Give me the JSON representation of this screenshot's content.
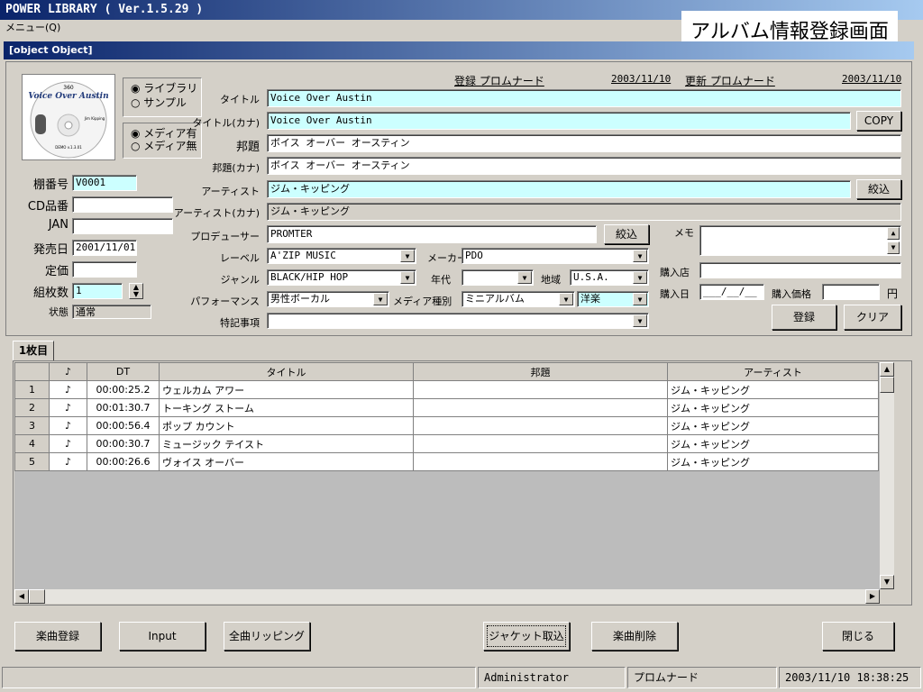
{
  "window": {
    "title": "POWER  LIBRARY ( Ver.1.5.29 )",
    "menu": "メニュー(Q)",
    "overlay_caption": "アルバム情報登録画面"
  },
  "form": {
    "title": {
      "label": "タイトル",
      "value": "Voice Over Austin"
    },
    "cover": {
      "top": "360",
      "title": "Voice Over Austin",
      "artist": "Jim Kipping",
      "demo": "DEMO v.1.3.01"
    },
    "source_radio": [
      {
        "label": "ライブラリ",
        "checked": true
      },
      {
        "label": "サンプル",
        "checked": false
      }
    ],
    "media_radio": [
      {
        "label": "メディア有",
        "checked": true
      },
      {
        "label": "メディア無",
        "checked": false
      }
    ],
    "left_fields": {
      "shelf_no": {
        "label": "棚番号",
        "value": "V0001"
      },
      "cd_no": {
        "label": "CD品番",
        "value": ""
      },
      "jan": {
        "label": "JAN",
        "value": ""
      },
      "release": {
        "label": "発売日",
        "value": "2001/11/01"
      },
      "price": {
        "label": "定価",
        "value": ""
      },
      "discs": {
        "label": "組枚数",
        "value": "1"
      },
      "status": {
        "label": "状態",
        "value": "通常"
      }
    },
    "registered": {
      "label": "登録 プロムナード",
      "date": "2003/11/10"
    },
    "updated": {
      "label": "更新 プロムナード",
      "date": "2003/11/10"
    },
    "title_kana": {
      "label": "タイトル(カナ)",
      "value": "Voice Over Austin"
    },
    "copy_button": "COPY",
    "jp_title": {
      "label": "邦題",
      "value": "ボイス オーバー オースティン"
    },
    "jp_title_kana": {
      "label": "邦題(カナ)",
      "value": "ボイス オーバー オースティン"
    },
    "artist": {
      "label": "アーティスト",
      "value": "ジム・キッピング"
    },
    "artist_kana": {
      "label": "アーティスト(カナ)",
      "value": "ジム・キッピング"
    },
    "narrow_button": "絞込",
    "producer": {
      "label": "プロデューサー",
      "value": "PROMTER"
    },
    "label": {
      "label": "レーベル",
      "value": "A'ZIP MUSIC"
    },
    "maker": {
      "label": "メーカー",
      "value": "PDO"
    },
    "genre": {
      "label": "ジャンル",
      "value": "BLACK/HIP HOP"
    },
    "era": {
      "label": "年代",
      "value": ""
    },
    "region": {
      "label": "地域",
      "value": "U.S.A."
    },
    "performance": {
      "label": "パフォーマンス",
      "value": "男性ボーカル"
    },
    "media_type": {
      "label": "メディア種別",
      "value": "ミニアルバム",
      "value2": "洋楽"
    },
    "notes": {
      "label": "特記事項",
      "value": ""
    },
    "memo": {
      "label": "メモ",
      "value": ""
    },
    "shop": {
      "label": "購入店",
      "value": ""
    },
    "purchase_date": {
      "label": "購入日",
      "value": "___/__/__"
    },
    "purchase_price": {
      "label": "購入価格",
      "value": "",
      "unit": "円"
    },
    "register_button": "登録",
    "clear_button": "クリア"
  },
  "tracks": {
    "tab": "1枚目",
    "columns": [
      "",
      "♪",
      "DT",
      "タイトル",
      "邦題",
      "アーティスト"
    ],
    "rows": [
      {
        "no": "1",
        "note": "♪",
        "dt": "00:00:25.2",
        "title": "ウェルカム アワー",
        "jp": "",
        "artist": "ジム・キッピング"
      },
      {
        "no": "2",
        "note": "♪",
        "dt": "00:01:30.7",
        "title": "トーキング ストーム",
        "jp": "",
        "artist": "ジム・キッピング"
      },
      {
        "no": "3",
        "note": "♪",
        "dt": "00:00:56.4",
        "title": "ポップ カウント",
        "jp": "",
        "artist": "ジム・キッピング"
      },
      {
        "no": "4",
        "note": "♪",
        "dt": "00:00:30.7",
        "title": "ミュージック テイスト",
        "jp": "",
        "artist": "ジム・キッピング"
      },
      {
        "no": "5",
        "note": "♪",
        "dt": "00:00:26.6",
        "title": "ヴォイス オーバー",
        "jp": "",
        "artist": "ジム・キッピング"
      }
    ]
  },
  "bottom_buttons": [
    "楽曲登録",
    "Input",
    "全曲リッピング",
    "ジャケット取込",
    "楽曲削除",
    "閉じる"
  ],
  "statusbar": {
    "left": "",
    "user": "Administrator",
    "name": "プロムナード",
    "datetime": "2003/11/10 18:38:25"
  }
}
